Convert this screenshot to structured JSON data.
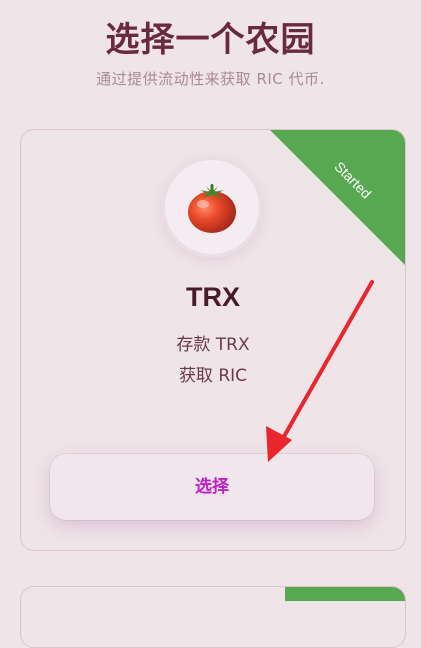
{
  "header": {
    "title": "选择一个农园",
    "subtitle": "通过提供流动性来获取 RIC 代币."
  },
  "farm_card": {
    "ribbon": "Started",
    "token_icon": "tomato-icon",
    "token_name": "TRX",
    "deposit_line": "存款 TRX",
    "earn_line": "获取 RIC",
    "select_label": "选择"
  },
  "colors": {
    "background": "#efe4e8",
    "title": "#6a2a3e",
    "ribbon": "#57a851",
    "button_text": "#c020c8",
    "arrow": "#e8262b"
  }
}
